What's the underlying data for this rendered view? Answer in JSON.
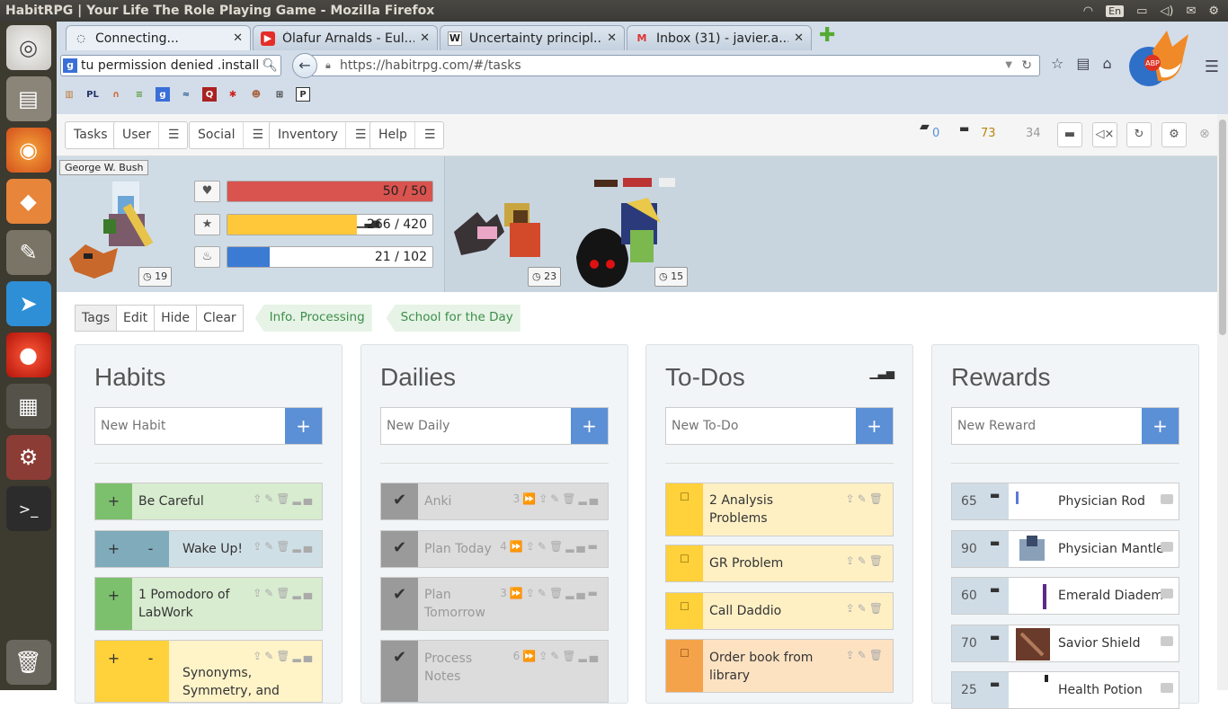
{
  "window": {
    "title": "HabitRPG | Your Life The Role Playing Game - Mozilla Firefox",
    "keyboard_lang": "En"
  },
  "browser": {
    "tabs": [
      {
        "label": "Connecting...",
        "icon": "loading-icon"
      },
      {
        "label": "Ólafur Arnalds - Eul...",
        "icon": "youtube-icon"
      },
      {
        "label": "Uncertainty principl...",
        "icon": "wikipedia-icon"
      },
      {
        "label": "Inbox (31) - javier.a....",
        "icon": "gmail-icon"
      }
    ],
    "search_value": "tu permission denied .install",
    "url": "https://habitrpg.com/#/tasks"
  },
  "nav": {
    "tasks": "Tasks",
    "user": "User",
    "social": "Social",
    "inventory": "Inventory",
    "help": "Help",
    "menu_glyph": "☰"
  },
  "currency": {
    "gems": "0",
    "gold": "73",
    "silver": "34"
  },
  "player": {
    "name": "George W. Bush",
    "level": "19",
    "hp": "50 / 50",
    "hp_frac": 1.0,
    "xp": "266 / 420",
    "xp_frac": 0.633,
    "mp": "21 / 102",
    "mp_frac": 0.206
  },
  "party": [
    {
      "level": "23"
    },
    {
      "level": "15"
    }
  ],
  "toolbar": {
    "tags": "Tags",
    "edit": "Edit",
    "hide": "Hide",
    "clear": "Clear",
    "tag1": "Info. Processing",
    "tag2": "School for the Day"
  },
  "habits": {
    "title": "Habits",
    "placeholder": "New Habit",
    "items": [
      {
        "label": "Be Careful",
        "plus": "+"
      },
      {
        "label": "Wake Up!",
        "plus": "+",
        "minus": "-"
      },
      {
        "label": "1 Pomodoro of LabWork",
        "plus": "+"
      },
      {
        "label": "Synonyms, Symmetry, and Simplicity",
        "plus": "+",
        "minus": "-"
      }
    ]
  },
  "dailies": {
    "title": "Dailies",
    "placeholder": "New Daily",
    "items": [
      {
        "label": "Anki",
        "streak": "3"
      },
      {
        "label": "Plan Today",
        "streak": "4"
      },
      {
        "label": "Plan Tomorrow",
        "streak": "3"
      },
      {
        "label": "Process Notes",
        "streak": "6"
      }
    ]
  },
  "todos": {
    "title": "To-Dos",
    "placeholder": "New To-Do",
    "items": [
      {
        "label": "2 Analysis Problems"
      },
      {
        "label": "GR Problem"
      },
      {
        "label": "Call Daddio"
      },
      {
        "label": "Order book from library"
      }
    ]
  },
  "rewards": {
    "title": "Rewards",
    "placeholder": "New Reward",
    "items": [
      {
        "price": "65",
        "label": "Physician Rod"
      },
      {
        "price": "90",
        "label": "Physician Mantle"
      },
      {
        "price": "60",
        "label": "Emerald Diadem"
      },
      {
        "price": "70",
        "label": "Savior Shield"
      },
      {
        "price": "25",
        "label": "Health Potion"
      }
    ]
  },
  "colors": {
    "hp": "#d9534f",
    "xp": "#ffc83a",
    "mp": "#3b7bd4",
    "habit_green": "#d8ecd0",
    "todo_yellow": "#fff0c4",
    "accent": "#5b8fd6"
  }
}
